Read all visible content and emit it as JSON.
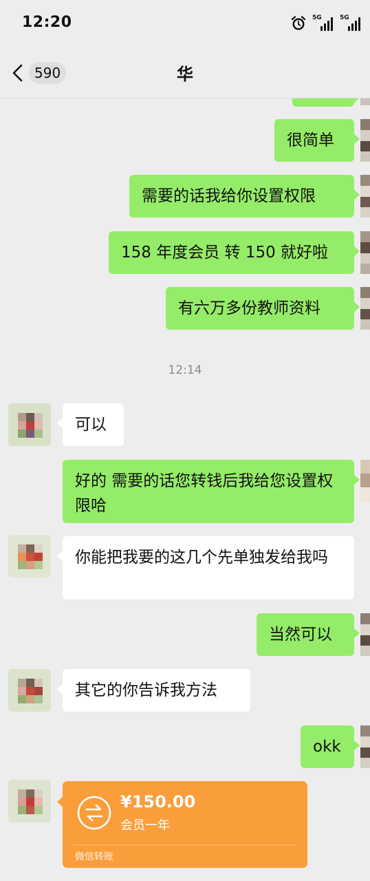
{
  "status": {
    "time": "12:20",
    "network_1": "5G",
    "network_2": "5G",
    "icons": [
      "alarm-icon",
      "signal-icon",
      "signal-icon"
    ]
  },
  "header": {
    "back_icon": "chevron-left-icon",
    "unread_count": "590",
    "title": "华"
  },
  "messages": [
    {
      "side": "sent",
      "text": "很简单"
    },
    {
      "side": "sent",
      "text": "需要的话我给你设置权限"
    },
    {
      "side": "sent",
      "text": "158 年度会员 转 150 就好啦"
    },
    {
      "side": "sent",
      "text": "有六万多份教师资料"
    },
    {
      "type": "time",
      "text": "12:14"
    },
    {
      "side": "received",
      "text": "可以"
    },
    {
      "side": "sent",
      "text": "好的 需要的话您转钱后我给您设置权限哈"
    },
    {
      "side": "received",
      "text": "你能把我要的这几个先单独发给我吗"
    },
    {
      "side": "sent",
      "text": "当然可以"
    },
    {
      "side": "received",
      "text": "其它的你告诉我方法"
    },
    {
      "side": "sent",
      "text": "okk"
    }
  ],
  "transfer": {
    "amount": "¥150.00",
    "note": "会员一年",
    "label": "微信转账",
    "icon": "transfer-icon"
  },
  "colors": {
    "sent_bubble": "#95ec69",
    "received_bubble": "#ffffff",
    "background": "#ededed",
    "transfer_card": "#fa9d3b"
  }
}
